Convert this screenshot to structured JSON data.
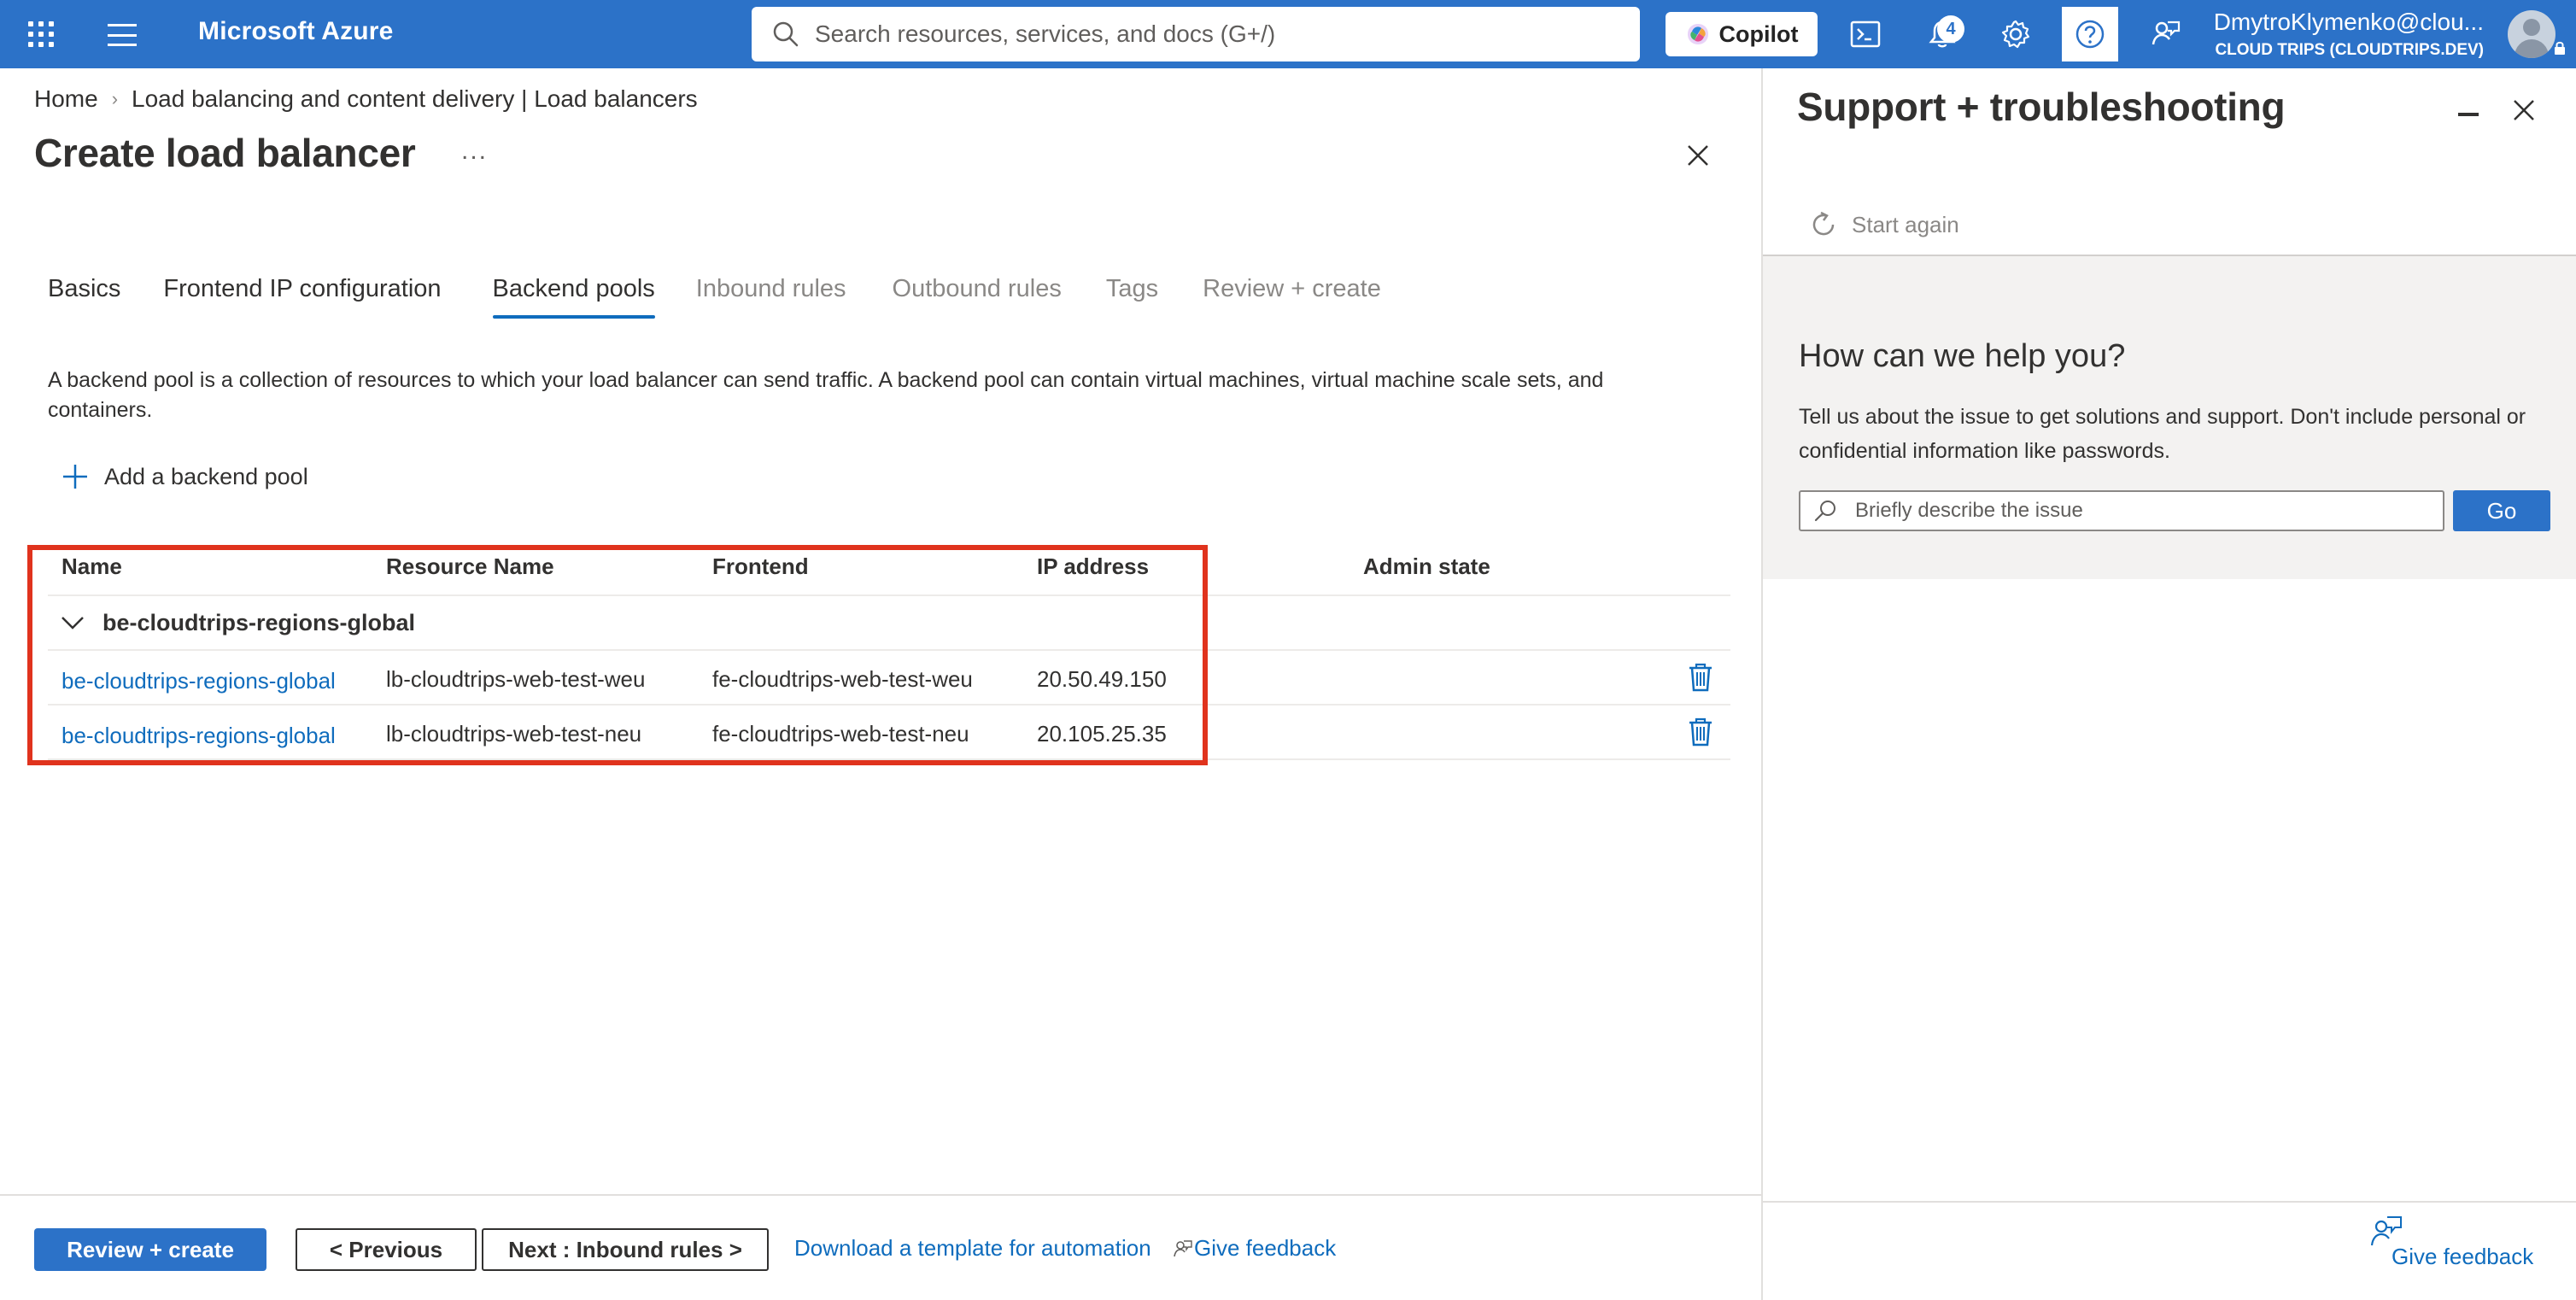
{
  "topbar": {
    "brand": "Microsoft Azure",
    "search_placeholder": "Search resources, services, and docs (G+/)",
    "copilot_label": "Copilot",
    "notifications_count": "4",
    "user_name": "DmytroKlymenko@clou...",
    "user_tenant": "CLOUD TRIPS (CLOUDTRIPS.DEV)",
    "bg_color": "#2c72c8"
  },
  "breadcrumb": {
    "home": "Home",
    "section": "Load balancing and content delivery | Load balancers"
  },
  "page": {
    "title": "Create load balancer",
    "more": "...",
    "description": "A backend pool is a collection of resources to which your load balancer can send traffic. A backend pool can contain virtual machines, virtual machine scale sets, and containers."
  },
  "tabs": [
    {
      "label": "Basics",
      "state": "enabled"
    },
    {
      "label": "Frontend IP configuration",
      "state": "enabled"
    },
    {
      "label": "Backend pools",
      "state": "active"
    },
    {
      "label": "Inbound rules",
      "state": "disabled"
    },
    {
      "label": "Outbound rules",
      "state": "disabled"
    },
    {
      "label": "Tags",
      "state": "disabled"
    },
    {
      "label": "Review + create",
      "state": "disabled"
    }
  ],
  "add_pool_label": "Add a backend pool",
  "grid": {
    "columns": [
      "Name",
      "Resource Name",
      "Frontend",
      "IP address",
      "Admin state"
    ],
    "group_name": "be-cloudtrips-regions-global",
    "rows": [
      {
        "name": "be-cloudtrips-regions-global",
        "resource": "lb-cloudtrips-web-test-weu",
        "frontend": "fe-cloudtrips-web-test-weu",
        "ip": "20.50.49.150",
        "admin_state": ""
      },
      {
        "name": "be-cloudtrips-regions-global",
        "resource": "lb-cloudtrips-web-test-neu",
        "frontend": "fe-cloudtrips-web-test-neu",
        "ip": "20.105.25.35",
        "admin_state": ""
      }
    ]
  },
  "footer": {
    "review_create": "Review + create",
    "previous": "< Previous",
    "next": "Next : Inbound rules >",
    "download_template": "Download a template for automation",
    "give_feedback": "Give feedback"
  },
  "support_panel": {
    "title": "Support + troubleshooting",
    "start_again": "Start again",
    "help_heading": "How can we help you?",
    "help_text": "Tell us about the issue to get solutions and support. Don't include personal or confidential information like passwords.",
    "input_placeholder": "Briefly describe the issue",
    "go_label": "Go",
    "give_feedback": "Give feedback"
  },
  "colors": {
    "accent": "#0f6cbd",
    "highlight": "#e0331d"
  }
}
